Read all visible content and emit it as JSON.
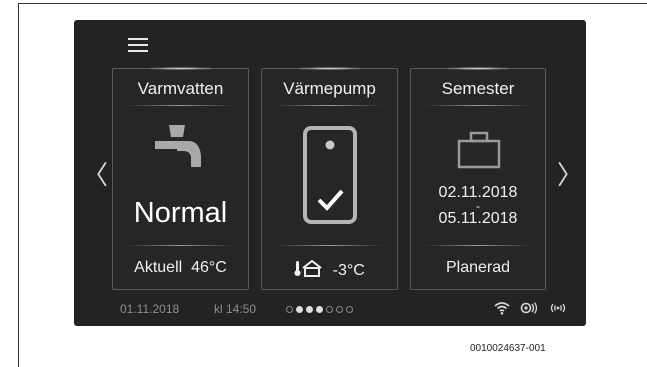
{
  "screen": {
    "menu_icon": "hamburger-menu-icon",
    "nav": {
      "left_icon": "chevron-left-icon",
      "left_glyph": "〈",
      "right_icon": "chevron-right-icon",
      "right_glyph": "〉"
    }
  },
  "tiles": [
    {
      "title": "Varmvatten",
      "icon": "faucet-icon",
      "value": "Normal",
      "footer_label": "Aktuell",
      "footer_value": "46°C"
    },
    {
      "title": "Värmepump",
      "icon": "heat-pump-check-icon",
      "footer_icon": "outdoor-temperature-icon",
      "footer_value": "-3°C"
    },
    {
      "title": "Semester",
      "icon": "suitcase-icon",
      "date_from": "02.11.2018",
      "date_separator": "-",
      "date_to": "05.11.2018",
      "footer_value": "Planerad"
    }
  ],
  "status_bar": {
    "date": "01.11.2018",
    "time": "kl 14:50",
    "pages": {
      "total": 7,
      "active": [
        1,
        2,
        3
      ]
    },
    "icons": [
      "wifi-icon",
      "connection-icon",
      "wireless-signal-icon"
    ]
  },
  "document_code": "0010024637-001",
  "colors": {
    "screen_background": "#232323",
    "tile_border": "#5a5a5a",
    "text": "#f0f0f0",
    "status_text": "#8f8f8f"
  }
}
